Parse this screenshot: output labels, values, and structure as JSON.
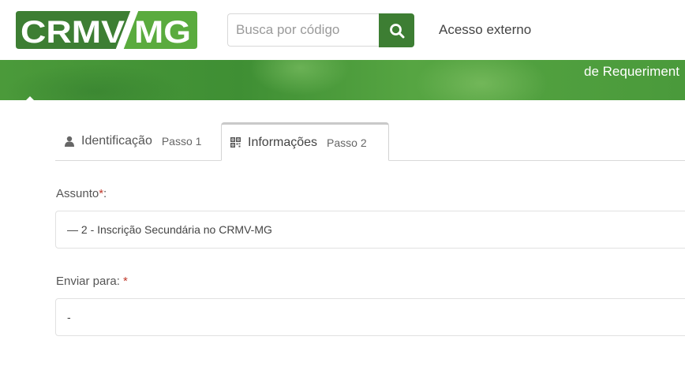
{
  "header": {
    "logo_text": "CRMV/MG",
    "search": {
      "placeholder": "Busca por código",
      "button_icon": "search-icon"
    },
    "external_link": "Acesso externo"
  },
  "banner": {
    "text": "de Requeriment"
  },
  "tabs": [
    {
      "label": "Identificação",
      "step": "Passo 1",
      "icon": "user-icon",
      "active": false
    },
    {
      "label": "Informações",
      "step": "Passo 2",
      "icon": "qr-code-icon",
      "active": true
    }
  ],
  "form": {
    "assunto": {
      "label": "Assunto",
      "required_mark": "*",
      "suffix": ":",
      "value": "— 2 - Inscrição Secundária no CRMV-MG"
    },
    "enviar_para": {
      "label": "Enviar para:",
      "required_mark": "*",
      "value": "-"
    }
  },
  "colors": {
    "brand_green": "#3d7e33",
    "banner_green": "#4b9a3a",
    "required": "#c0392b"
  }
}
